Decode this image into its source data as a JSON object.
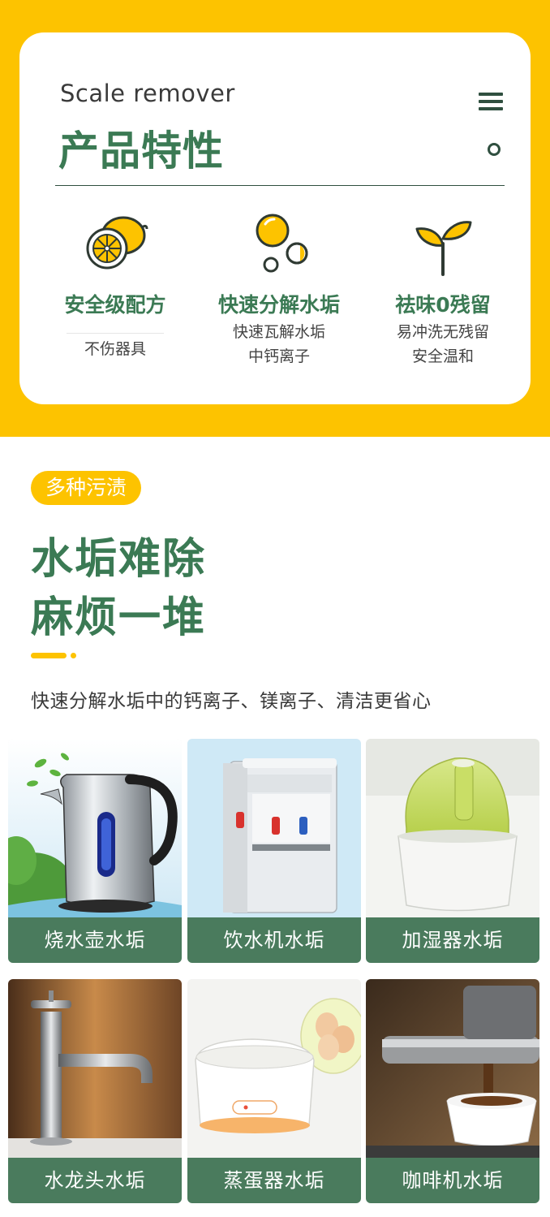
{
  "header": {
    "subtitle": "Scale remover",
    "title": "产品特性"
  },
  "features": [
    {
      "icon": "lemon-icon",
      "title": "安全级配方",
      "lines": [
        "不伤器具"
      ]
    },
    {
      "icon": "bubbles-icon",
      "title": "快速分解水垢",
      "lines": [
        "快速瓦解水垢",
        "中钙离子"
      ]
    },
    {
      "icon": "sprout-icon",
      "title": "祛味0残留",
      "lines": [
        "易冲洗无残留",
        "安全温和"
      ]
    }
  ],
  "section": {
    "tag": "多种污渍",
    "headline_1": "水垢难除",
    "headline_2": "麻烦一堆",
    "description": "快速分解水垢中的钙离子、镁离子、清洁更省心"
  },
  "tiles": [
    {
      "label": "烧水壶水垢",
      "image": "electric kettle"
    },
    {
      "label": "饮水机水垢",
      "image": "water dispenser"
    },
    {
      "label": "加湿器水垢",
      "image": "humidifier"
    },
    {
      "label": "水龙头水垢",
      "image": "faucet"
    },
    {
      "label": "蒸蛋器水垢",
      "image": "egg steamer"
    },
    {
      "label": "咖啡机水垢",
      "image": "coffee machine"
    }
  ],
  "colors": {
    "brand_yellow": "#fdc300",
    "brand_green": "#3b7a54",
    "label_green": "#4a7b5d"
  }
}
